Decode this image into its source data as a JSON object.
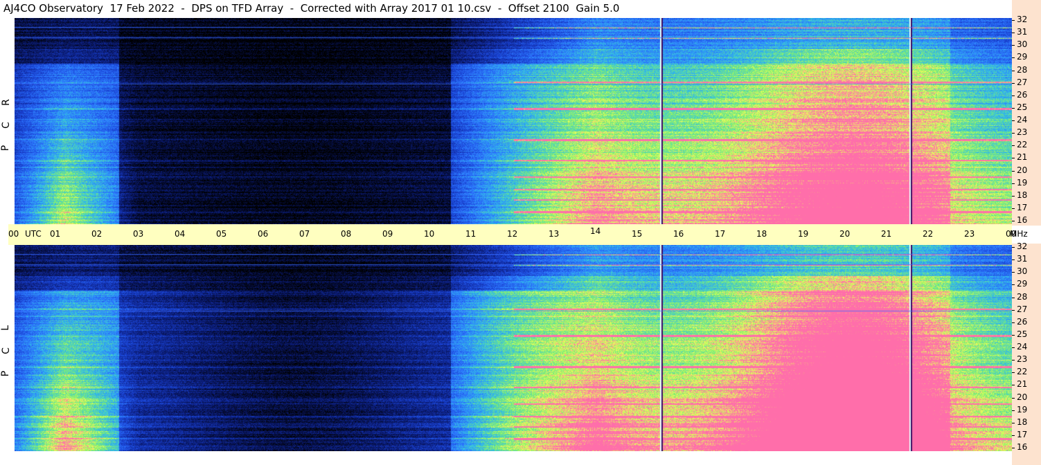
{
  "title": "AJ4CO Observatory  17 Feb 2022  -  DPS on TFD Array  -  Corrected with Array 2017 01 10.csv  -  Offset 2100  Gain 5.0",
  "chart_data": {
    "type": "heatmap",
    "title": "AJ4CO Observatory  17 Feb 2022  -  DPS on TFD Array  -  Corrected with Array 2017 01 10.csv  -  Offset 2100  Gain 5.0",
    "x_unit_label": "UTC",
    "x_tick_labels": [
      "00",
      "01",
      "02",
      "03",
      "04",
      "05",
      "06",
      "07",
      "08",
      "09",
      "10",
      "11",
      "12",
      "13",
      "14",
      "15",
      "16",
      "17",
      "18",
      "19",
      "20",
      "21",
      "22",
      "23",
      "00"
    ],
    "y_unit_label": "MHz",
    "y_tick_labels": [
      "32",
      "31",
      "30",
      "29",
      "28",
      "27",
      "26",
      "25",
      "24",
      "23",
      "22",
      "21",
      "20",
      "19",
      "18",
      "17",
      "16"
    ],
    "ylim": [
      16,
      32
    ],
    "panels": [
      {
        "label": "RCP",
        "polarization_letters": [
          "R",
          "C",
          "P"
        ]
      },
      {
        "label": "LCP",
        "polarization_letters": [
          "L",
          "C",
          "P"
        ]
      }
    ],
    "vertical_markers_utc": [
      15.55,
      21.55
    ],
    "color_scale": [
      "#000000",
      "#0b1a70",
      "#1a3fd0",
      "#2b7cff",
      "#33c0e8",
      "#80f070",
      "#f0ff60",
      "#ff60a0"
    ]
  }
}
